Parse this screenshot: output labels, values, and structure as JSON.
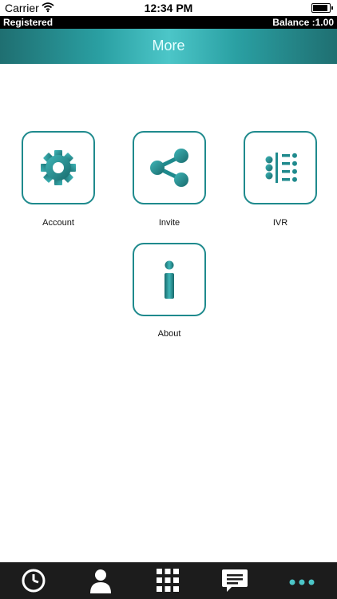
{
  "status": {
    "carrier": "Carrier",
    "time": "12:34 PM"
  },
  "account_bar": {
    "status": "Registered",
    "balance": "Balance :1.00"
  },
  "header": {
    "title": "More"
  },
  "menu": {
    "account": "Account",
    "invite": "Invite",
    "ivr": "IVR",
    "about": "About"
  },
  "colors": {
    "accent": "#1f8a8d",
    "tab_bar": "#1c1c1c",
    "active_tab": "#4cc6c8"
  },
  "tabs": [
    {
      "icon": "clock-icon"
    },
    {
      "icon": "contact-icon"
    },
    {
      "icon": "dialpad-icon"
    },
    {
      "icon": "message-icon"
    },
    {
      "icon": "more-dots-icon",
      "active": true
    }
  ]
}
